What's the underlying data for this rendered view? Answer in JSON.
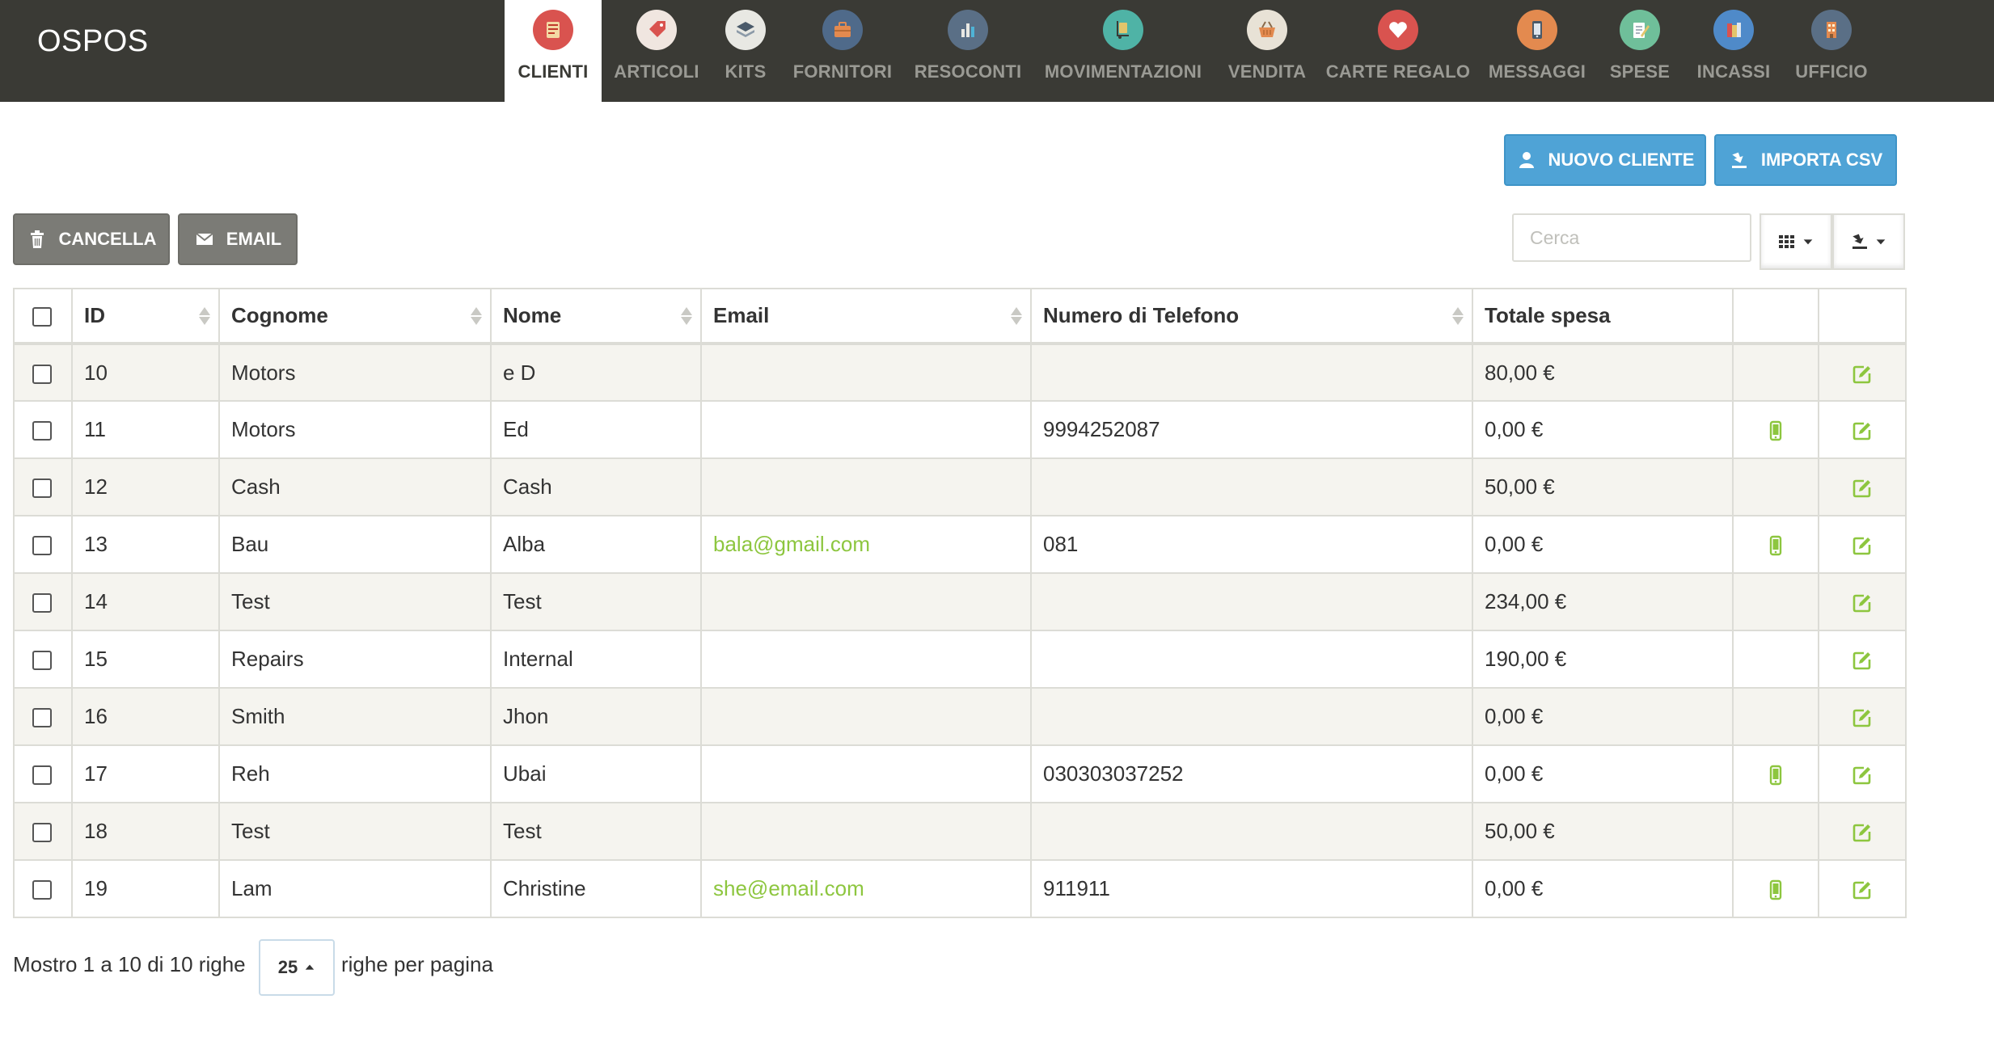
{
  "brand": "OSPOS",
  "nav": [
    {
      "label": "CLIENTI",
      "icon": "customers-icon",
      "color": "#d9534f",
      "active": true
    },
    {
      "label": "ARTICOLI",
      "icon": "items-tag-icon",
      "color": "#e06b6b"
    },
    {
      "label": "KITS",
      "icon": "kits-layers-icon",
      "color": "#8c9aa8"
    },
    {
      "label": "FORNITORI",
      "icon": "suppliers-briefcase-icon",
      "color": "#4f6a8a"
    },
    {
      "label": "RESOCONTI",
      "icon": "reports-chart-icon",
      "color": "#5a6f86"
    },
    {
      "label": "MOVIMENTAZIONI",
      "icon": "receivings-dolly-icon",
      "color": "#4fb3a6"
    },
    {
      "label": "VENDITA",
      "icon": "sales-basket-icon",
      "color": "#e8e2d6"
    },
    {
      "label": "CARTE REGALO",
      "icon": "giftcards-heart-icon",
      "color": "#d9534f"
    },
    {
      "label": "MESSAGGI",
      "icon": "messages-phone-icon",
      "color": "#e38a4f"
    },
    {
      "label": "SPESE",
      "icon": "expenses-notepad-icon",
      "color": "#6fbf9a"
    },
    {
      "label": "INCASSI",
      "icon": "cashups-books-icon",
      "color": "#4f8ac9"
    },
    {
      "label": "UFFICIO",
      "icon": "office-building-icon",
      "color": "#5a6f86"
    }
  ],
  "toolbar": {
    "new_customer": "NUOVO CLIENTE",
    "import_csv": "IMPORTA CSV",
    "delete": "CANCELLA",
    "email": "EMAIL",
    "search_placeholder": "Cerca"
  },
  "table": {
    "columns": [
      "ID",
      "Cognome",
      "Nome",
      "Email",
      "Numero di Telefono",
      "Totale spesa"
    ],
    "rows": [
      {
        "id": "10",
        "surname": "Motors",
        "name": "e D",
        "email": "",
        "phone": "",
        "total": "80,00 €",
        "mobile": false
      },
      {
        "id": "11",
        "surname": "Motors",
        "name": "Ed",
        "email": "",
        "phone": "9994252087",
        "total": "0,00 €",
        "mobile": true
      },
      {
        "id": "12",
        "surname": "Cash",
        "name": "Cash",
        "email": "",
        "phone": "",
        "total": "50,00 €",
        "mobile": false
      },
      {
        "id": "13",
        "surname": "Bau",
        "name": "Alba",
        "email": "bala@gmail.com",
        "phone": "081",
        "total": "0,00 €",
        "mobile": true
      },
      {
        "id": "14",
        "surname": "Test",
        "name": "Test",
        "email": "",
        "phone": "",
        "total": "234,00 €",
        "mobile": false
      },
      {
        "id": "15",
        "surname": "Repairs",
        "name": "Internal",
        "email": "",
        "phone": "",
        "total": "190,00 €",
        "mobile": false
      },
      {
        "id": "16",
        "surname": "Smith",
        "name": "Jhon",
        "email": "",
        "phone": "",
        "total": "0,00 €",
        "mobile": false
      },
      {
        "id": "17",
        "surname": "Reh",
        "name": "Ubai",
        "email": "",
        "phone": "030303037252",
        "total": "0,00 €",
        "mobile": true
      },
      {
        "id": "18",
        "surname": "Test",
        "name": "Test",
        "email": "",
        "phone": "",
        "total": "50,00 €",
        "mobile": false
      },
      {
        "id": "19",
        "surname": "Lam",
        "name": "Christine",
        "email": "she@email.com",
        "phone": "911911",
        "total": "0,00 €",
        "mobile": true
      }
    ]
  },
  "pagination": {
    "summary": "Mostro 1 a 10 di 10 righe",
    "page_size": "25",
    "suffix": "righe per pagina"
  },
  "colors": {
    "navbar": "#3a3a35",
    "primary_button": "#4fa3d6",
    "gray_button": "#7b7b76",
    "accent_green": "#8dc63f"
  }
}
